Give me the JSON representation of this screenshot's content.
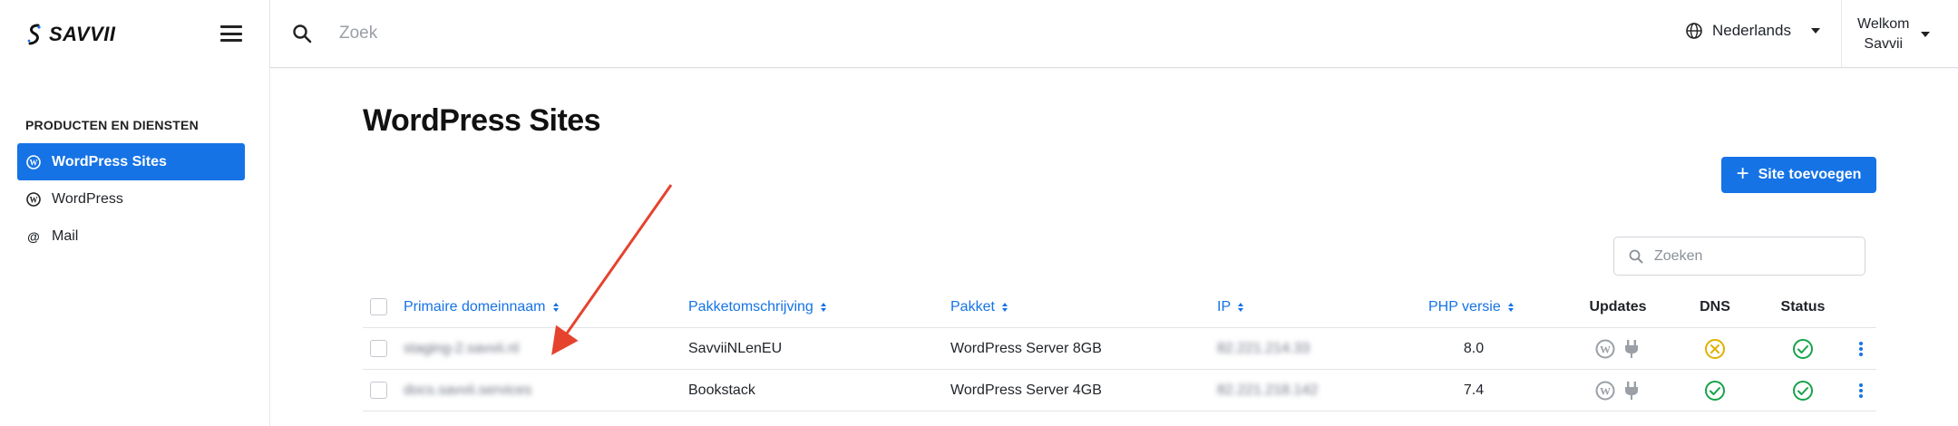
{
  "brand": {
    "name": "SAVVII"
  },
  "sidebar": {
    "section_title": "PRODUCTEN EN DIENSTEN",
    "items": [
      {
        "label": "WordPress Sites",
        "icon": "wordpress-icon",
        "active": true
      },
      {
        "label": "WordPress",
        "icon": "wordpress-icon",
        "active": false
      },
      {
        "label": "Mail",
        "icon": "at-icon",
        "active": false
      }
    ]
  },
  "topbar": {
    "search_placeholder": "Zoek",
    "language": "Nederlands",
    "user_line1": "Welkom",
    "user_line2": "Savvii"
  },
  "main": {
    "title": "WordPress Sites",
    "add_button_label": "Site toevoegen",
    "table_search_placeholder": "Zoeken",
    "columns": {
      "domain": "Primaire domeinnaam",
      "package_desc": "Pakketomschrijving",
      "package": "Pakket",
      "ip": "IP",
      "php": "PHP versie",
      "updates": "Updates",
      "dns": "DNS",
      "status": "Status"
    },
    "rows": [
      {
        "domain": "staging-2.savvii.nl",
        "package_desc": "SavviiNLenEU",
        "package": "WordPress Server 8GB",
        "ip": "82.221.214.33",
        "php": "8.0",
        "dns_state": "error",
        "status_state": "ok"
      },
      {
        "domain": "docs.savvii.services",
        "package_desc": "Bookstack",
        "package": "WordPress Server 4GB",
        "ip": "82.221.218.142",
        "php": "7.4",
        "dns_state": "ok",
        "status_state": "ok"
      }
    ]
  },
  "colors": {
    "primary": "#1573e6",
    "success": "#16a34a",
    "warning": "#e0b000",
    "annotation": "#e5432e"
  }
}
